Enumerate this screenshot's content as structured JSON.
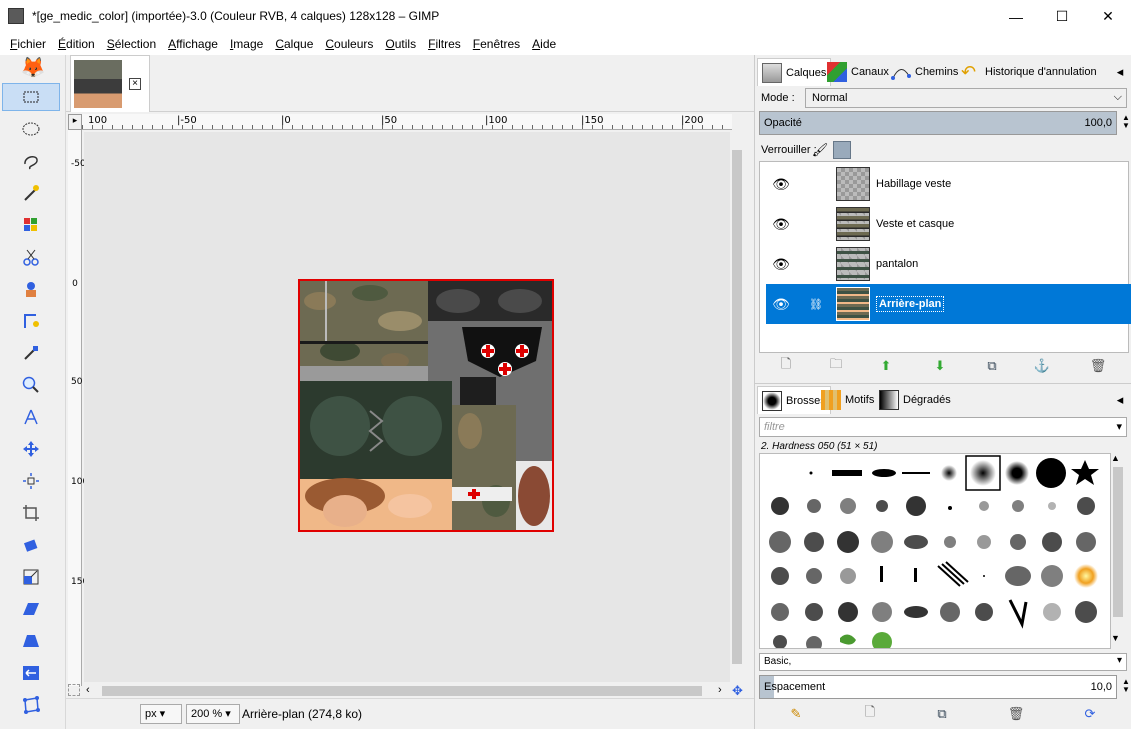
{
  "window": {
    "title": "*[ge_medic_color] (importée)-3.0 (Couleur RVB, 4 calques) 128x128 – GIMP",
    "minimize": "—",
    "maximize": "☐",
    "close": "✕"
  },
  "menubar": {
    "items": [
      {
        "u": "F",
        "rest": "ichier"
      },
      {
        "u": "É",
        "rest": "dition"
      },
      {
        "u": "S",
        "rest": "élection"
      },
      {
        "u": "A",
        "rest": "ffichage"
      },
      {
        "u": "I",
        "rest": "mage"
      },
      {
        "u": "C",
        "rest": "alque"
      },
      {
        "u": "C",
        "rest": "ouleurs"
      },
      {
        "u": "O",
        "rest": "utils"
      },
      {
        "u": "F",
        "rest": "iltres"
      },
      {
        "u": "F",
        "rest": "enêtres"
      },
      {
        "u": "A",
        "rest": "ide"
      }
    ]
  },
  "image_tab": {
    "close": "×"
  },
  "ruler": {
    "h_labels": [
      "100",
      "|-50",
      "|0",
      "|50",
      "|100",
      "|150",
      "|200"
    ],
    "v_labels": [
      "-50",
      "0",
      "50",
      "100",
      "150"
    ]
  },
  "statusbar": {
    "unit": "px",
    "zoom": "200 %",
    "message": "Arrière-plan (274,8 ko)"
  },
  "layers_dock": {
    "tabs": [
      "Calques",
      "Canaux",
      "Chemins",
      "Historique d'annulation"
    ],
    "mode_label": "Mode :",
    "mode_value": "Normal",
    "opacity_label": "Opacité",
    "opacity_value": "100,0",
    "opacity_percent": 100,
    "lock_label": "Verrouiller :",
    "layers": [
      {
        "name": "Habillage veste",
        "visible": true,
        "selected": false
      },
      {
        "name": "Veste et casque",
        "visible": true,
        "selected": false
      },
      {
        "name": "pantalon",
        "visible": true,
        "selected": false
      },
      {
        "name": "Arrière-plan",
        "visible": true,
        "selected": true
      }
    ]
  },
  "brushes_dock": {
    "tabs": [
      "Brosses",
      "Motifs",
      "Dégradés"
    ],
    "filter_placeholder": "filtre",
    "current_brush": "2. Hardness 050 (51 × 51)",
    "tag_value": "Basic,",
    "spacing_label": "Espacement",
    "spacing_value": "10,0"
  },
  "colors": {
    "accent": "#0078d7",
    "image_border": "#e00000",
    "canvas_bg": "#e6e6e6"
  }
}
